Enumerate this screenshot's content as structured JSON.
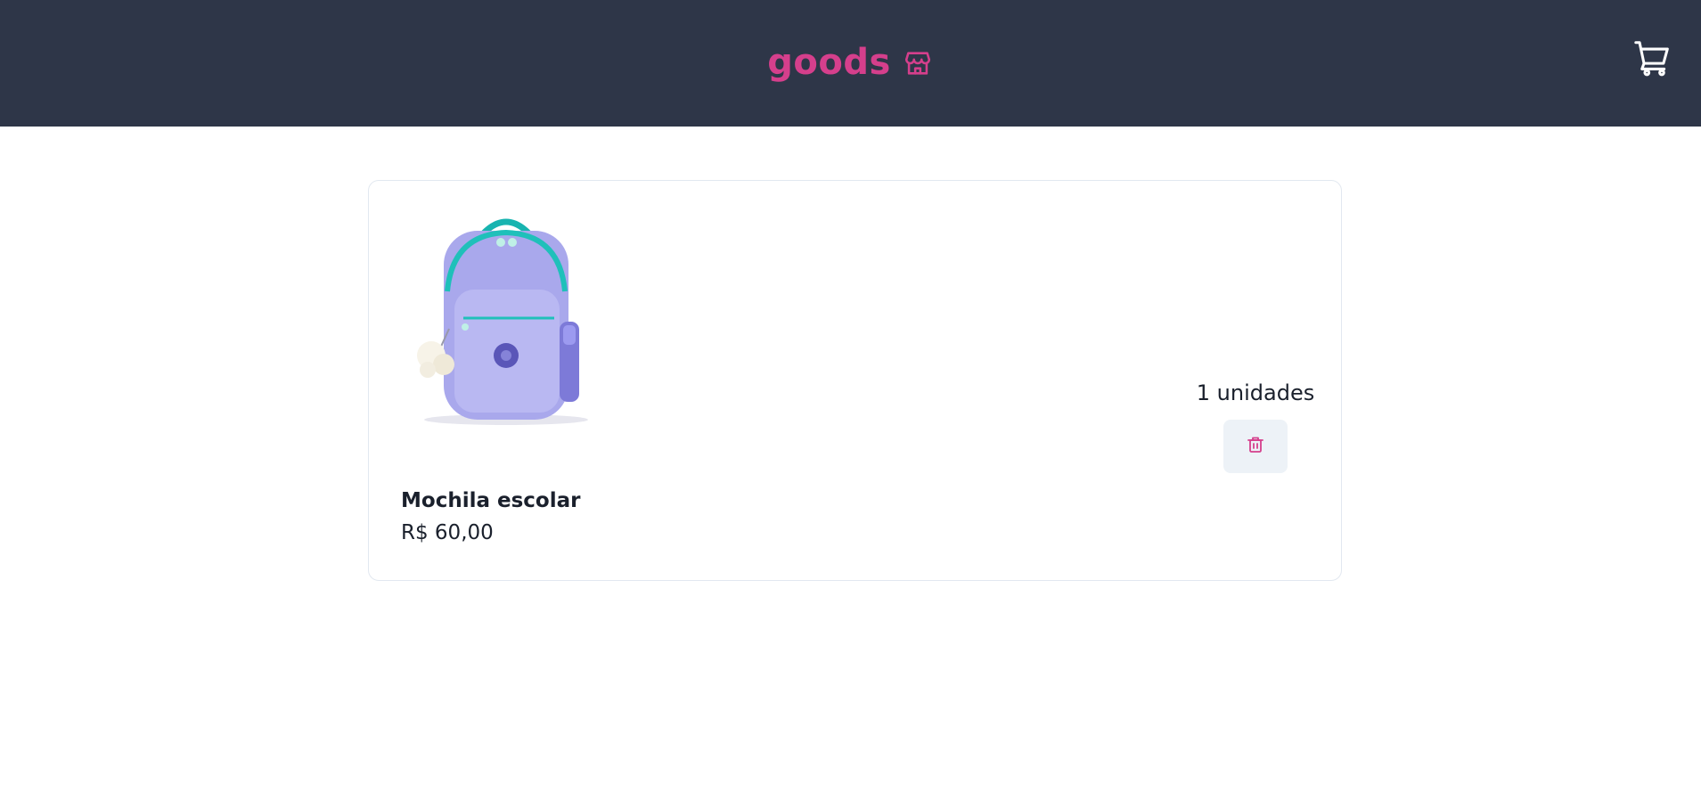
{
  "header": {
    "brand_name": "goods",
    "brand_icon": "store-icon",
    "cart_icon": "shopping-cart-icon",
    "background_color": "#2e3648",
    "brand_color": "#d53f8c"
  },
  "cart": {
    "items": [
      {
        "name": "Mochila escolar",
        "price": "R$ 60,00",
        "quantity_label": "1 unidades",
        "image_icon": "backpack-image",
        "delete_icon": "trash-icon"
      }
    ]
  }
}
